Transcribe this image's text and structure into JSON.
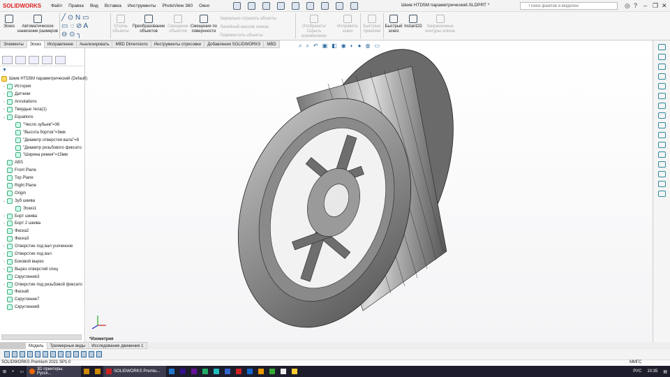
{
  "app": {
    "logo": "SOLIDWORKS",
    "doc_title": "Шкив HTD5M параметрический.SLDPRT *",
    "search_placeholder": "Поиск файлов и моделей"
  },
  "menu": [
    "Файл",
    "Правка",
    "Вид",
    "Вставка",
    "Инструменты",
    "PhotoView 360",
    "Окно"
  ],
  "ribbon": {
    "sketch": "Эскиз",
    "auto_dim": "Автоматическое нанесение размеров",
    "trim": "Отсечь объекты",
    "convert": "Преобразование объектов",
    "offset": "Смещение объектов",
    "offset_surface": "Смещение по поверхности",
    "mirror": "Зеркально отразить объекты",
    "linear_pattern": "Линейный массив эскиза",
    "move": "Переместить объекты",
    "show_relations": "Отобразить/Скрыть взаимосвязи",
    "repair": "Исправить эскиз",
    "quick_snaps": "Быстрые привязки",
    "rapid_sketch": "Быстрый эскиз",
    "instant2d": "Instant2D",
    "shaded_contours": "Закрашенные контуры эскиза"
  },
  "tabs": [
    "Элементы",
    "Эскиз",
    "Исправление",
    "Анализировать",
    "MBD Dimensions",
    "Инструменты отрисовки",
    "Добавления SOLIDWORKS",
    "MBD"
  ],
  "tree": {
    "root": "Шкив HTD5M параметрический  (Default)",
    "items": [
      {
        "label": "История",
        "exp": "›",
        "ind": 0
      },
      {
        "label": "Датчики",
        "exp": "›",
        "ind": 0
      },
      {
        "label": "Annotations",
        "exp": "›",
        "ind": 0
      },
      {
        "label": "Твердые тела(1)",
        "exp": "›",
        "ind": 0
      },
      {
        "label": "Equations",
        "exp": "⌄",
        "ind": 0
      },
      {
        "label": "\"Число зубьев\"=36",
        "exp": "",
        "ind": 2
      },
      {
        "label": "\"Высота бортов\"=3мм",
        "exp": "",
        "ind": 2
      },
      {
        "label": "\"Диаметр отверстия вала\"=8",
        "exp": "",
        "ind": 2
      },
      {
        "label": "\"Диаметр резьбового фиксато",
        "exp": "",
        "ind": 2
      },
      {
        "label": "\"Ширина ремня\"=15мм",
        "exp": "",
        "ind": 2
      },
      {
        "label": "ABS",
        "exp": "",
        "ind": 0
      },
      {
        "label": "Front Plane",
        "exp": "",
        "ind": 0
      },
      {
        "label": "Top Plane",
        "exp": "",
        "ind": 0
      },
      {
        "label": "Right Plane",
        "exp": "",
        "ind": 0
      },
      {
        "label": "Origin",
        "exp": "",
        "ind": 0
      },
      {
        "label": "Зуб шкива",
        "exp": "⌄",
        "ind": 0
      },
      {
        "label": "Эскиз1",
        "exp": "",
        "ind": 2
      },
      {
        "label": "Борт шкива",
        "exp": "›",
        "ind": 0
      },
      {
        "label": "Борт 2 шкива",
        "exp": "›",
        "ind": 0
      },
      {
        "label": "Фаска2",
        "exp": "",
        "ind": 0
      },
      {
        "label": "Фаска3",
        "exp": "",
        "ind": 0
      },
      {
        "label": "Отверстие под вал усеченное",
        "exp": "›",
        "ind": 0
      },
      {
        "label": "Отверстие под вал",
        "exp": "›",
        "ind": 0
      },
      {
        "label": "Боковой вырез",
        "exp": "›",
        "ind": 0
      },
      {
        "label": "Вырез отверстий спиц",
        "exp": "›",
        "ind": 0
      },
      {
        "label": "Скругление3",
        "exp": "",
        "ind": 0
      },
      {
        "label": "Отверстие под резьбовой фиксато",
        "exp": "›",
        "ind": 0
      },
      {
        "label": "Фаска6",
        "exp": "",
        "ind": 0
      },
      {
        "label": "Скругление7",
        "exp": "",
        "ind": 0
      },
      {
        "label": "Скругление8",
        "exp": "",
        "ind": 0
      }
    ]
  },
  "view_label": "*Изометрия",
  "bottom_tabs": [
    "Модель",
    "Трехмерные виды",
    "Исследование движения 1"
  ],
  "status": {
    "version": "SOLIDWORKS Premium 2021 SP1.0",
    "units": "ММГС"
  },
  "taskbar": {
    "firefox": "3D принтеры. Русск...",
    "solidworks": "SOLIDWORKS Premiu...",
    "lang": "РУС",
    "time": "10:35"
  }
}
